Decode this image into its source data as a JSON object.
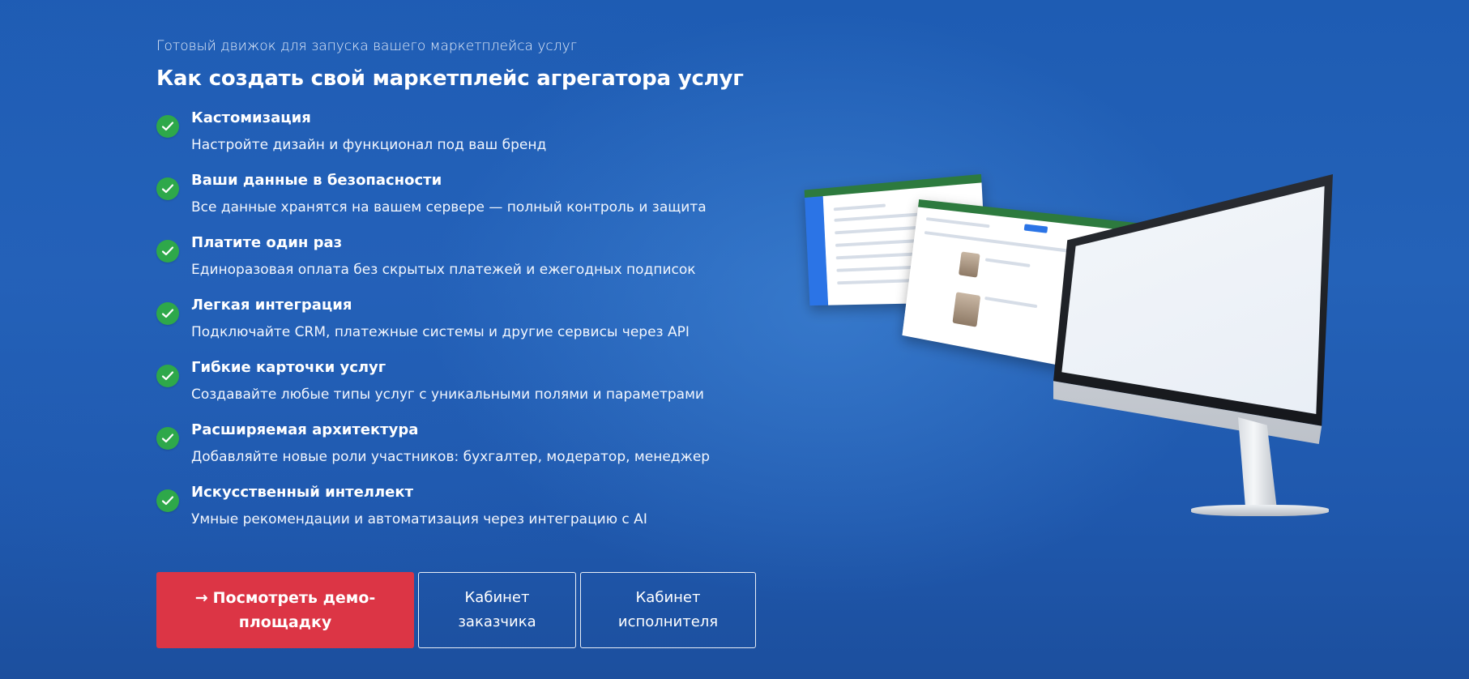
{
  "hero": {
    "eyebrow": "Готовый движок для запуска вашего маркетплейса услуг",
    "title": "Как создать свой маркетплейс агрегатора услуг"
  },
  "features": [
    {
      "title": "Кастомизация",
      "description": "Настройте дизайн и функционал под ваш бренд",
      "icon": "check-circle-icon"
    },
    {
      "title": "Ваши данные в безопасности",
      "description": "Все данные хранятся на вашем сервере — полный контроль и защита",
      "icon": "check-circle-icon"
    },
    {
      "title": "Платите один раз",
      "description": "Единоразовая оплата без скрытых платежей и ежегодных подписок",
      "icon": "check-circle-icon"
    },
    {
      "title": "Легкая интеграция",
      "description": "Подключайте CRM, платежные системы и другие сервисы через API",
      "icon": "check-circle-icon"
    },
    {
      "title": "Гибкие карточки услуг",
      "description": "Создавайте любые типы услуг с уникальными полями и параметрами",
      "icon": "check-circle-icon"
    },
    {
      "title": "Расширяемая архитектура",
      "description": "Добавляйте новые роли участников: бухгалтер, модератор, менеджер",
      "icon": "check-circle-icon"
    },
    {
      "title": "Искусственный интеллект",
      "description": "Умные рекомендации и автоматизация через интеграцию с AI",
      "icon": "check-circle-icon"
    }
  ],
  "actions": {
    "demo_arrow": "→",
    "demo_label": "Посмотреть демо-площадку",
    "customer_label": "Кабинет заказчика",
    "executor_label": "Кабинет исполнителя"
  },
  "colors": {
    "background": "#2462b8",
    "check": "#2ea84a",
    "primary_button": "#dc3545"
  }
}
